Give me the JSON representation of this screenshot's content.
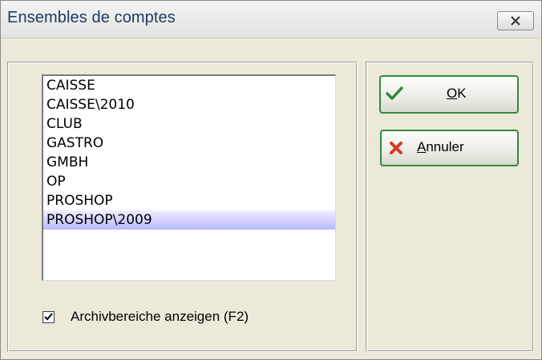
{
  "window": {
    "title": "Ensembles de comptes",
    "close_icon": "close-x-icon"
  },
  "list": {
    "items": [
      "CAISSE",
      "CAISSE\\2010",
      "CLUB",
      "GASTRO",
      "GMBH",
      "OP",
      "PROSHOP",
      "PROSHOP\\2009"
    ],
    "selected": "PROSHOP\\2009",
    "selected_color": "#b9b9ff"
  },
  "checkbox": {
    "label": "Archivbereiche anzeigen (F2)",
    "checked": true
  },
  "buttons": {
    "ok": {
      "mnemonic": "O",
      "rest": "K",
      "icon": "checkmark-icon",
      "icon_color": "#2e8b3a"
    },
    "cancel": {
      "mnemonic": "A",
      "rest": "nnuler",
      "icon": "red-x-icon",
      "icon_color": "#d63a1f"
    },
    "border_color": "#2f8a3e"
  }
}
